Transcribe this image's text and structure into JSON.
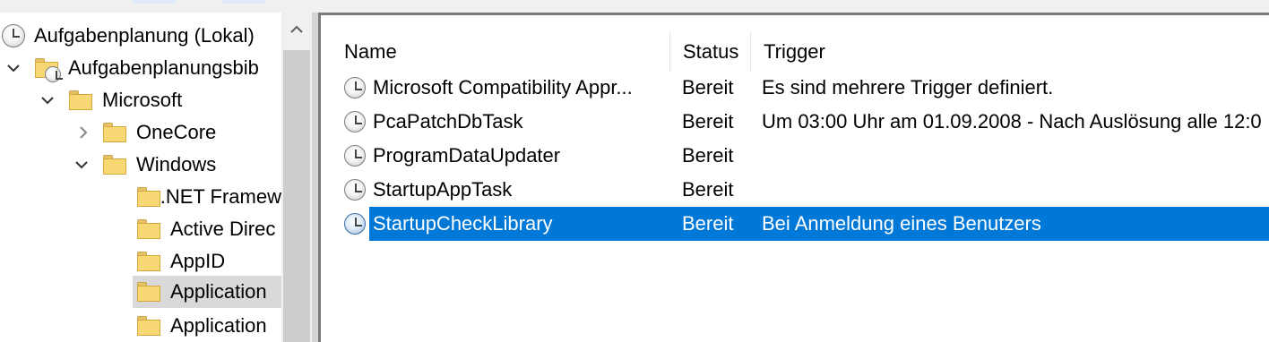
{
  "tree": {
    "root_label": "Aufgabenplanung (Lokal)",
    "library_label": "Aufgabenplanungsbib",
    "microsoft_label": "Microsoft",
    "onecore_label": "OneCore",
    "windows_label": "Windows",
    "items": [
      ".NET Framew",
      "Active Direc",
      "AppID",
      "Application",
      "Application"
    ]
  },
  "list": {
    "columns": [
      "Name",
      "Status",
      "Trigger"
    ],
    "rows": [
      {
        "name": "Microsoft Compatibility Appr...",
        "status": "Bereit",
        "trigger": "Es sind mehrere Trigger definiert."
      },
      {
        "name": "PcaPatchDbTask",
        "status": "Bereit",
        "trigger": "Um 03:00 Uhr am 01.09.2008 - Nach Auslösung alle 12:0"
      },
      {
        "name": "ProgramDataUpdater",
        "status": "Bereit",
        "trigger": ""
      },
      {
        "name": "StartupAppTask",
        "status": "Bereit",
        "trigger": ""
      },
      {
        "name": "StartupCheckLibrary",
        "status": "Bereit",
        "trigger": "Bei Anmeldung eines Benutzers"
      }
    ],
    "selected_index": 4
  },
  "colors": {
    "selection": "#0078d7",
    "tree_selection": "#d9d9d9",
    "folder": "#f8d775"
  },
  "icons": {
    "task": "clock-icon",
    "folder": "folder-icon",
    "expand": "chevron-down-icon",
    "collapsed": "chevron-right-icon"
  }
}
